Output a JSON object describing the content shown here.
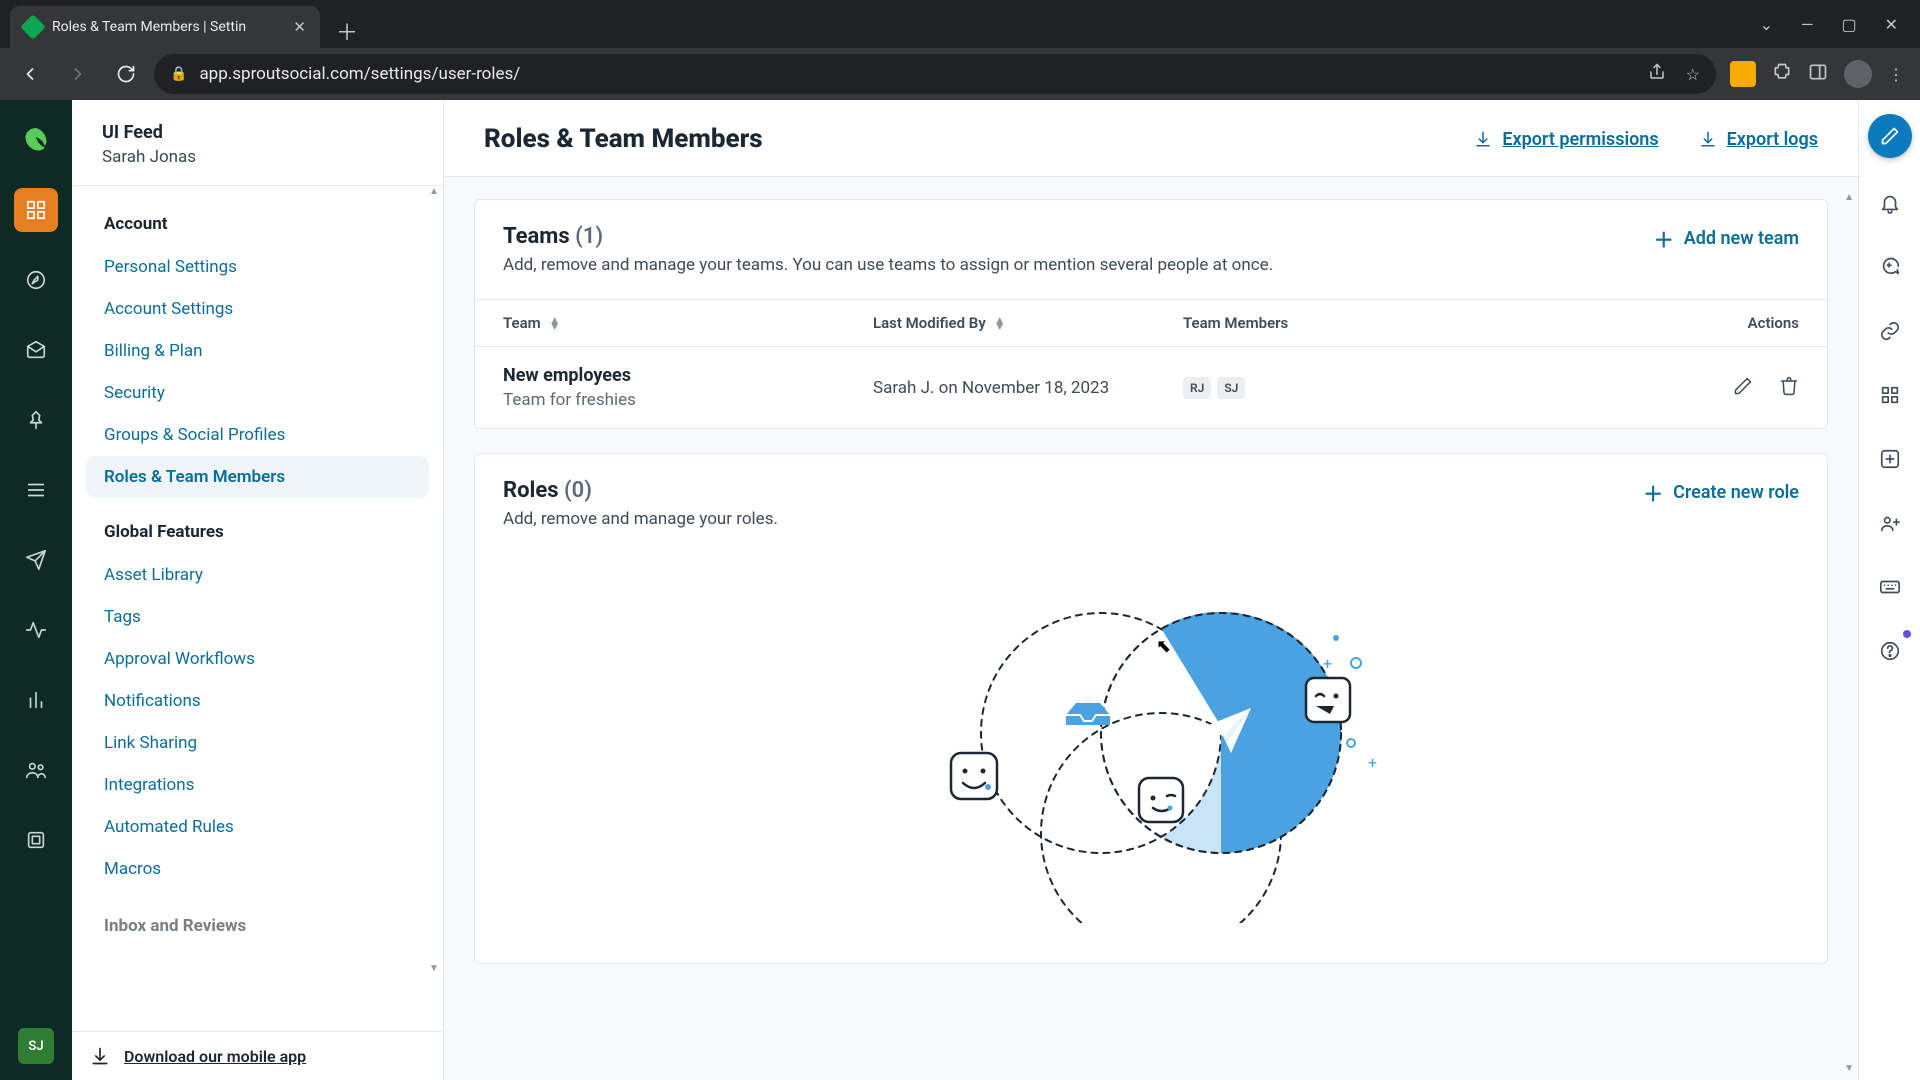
{
  "browser": {
    "tab_title": "Roles & Team Members | Settin",
    "url": "app.sproutsocial.com/settings/user-roles/"
  },
  "sidebar": {
    "org": "UI Feed",
    "user": "Sarah Jonas",
    "user_initials": "SJ",
    "sections": [
      {
        "title": "Account",
        "items": [
          "Personal Settings",
          "Account Settings",
          "Billing & Plan",
          "Security",
          "Groups & Social Profiles",
          "Roles & Team Members"
        ],
        "active_index": 5
      },
      {
        "title": "Global Features",
        "items": [
          "Asset Library",
          "Tags",
          "Approval Workflows",
          "Notifications",
          "Link Sharing",
          "Integrations",
          "Automated Rules",
          "Macros"
        ]
      }
    ],
    "peek_section": "Inbox and Reviews",
    "mobile_cta": "Download our mobile app"
  },
  "header": {
    "title": "Roles & Team Members",
    "export_permissions": "Export permissions",
    "export_logs": "Export logs"
  },
  "teams": {
    "title": "Teams",
    "count": "(1)",
    "subtitle": "Add, remove and manage your teams. You can use teams to assign or mention several people at once.",
    "add_label": "Add new team",
    "columns": {
      "team": "Team",
      "modified": "Last Modified By",
      "members": "Team Members",
      "actions": "Actions"
    },
    "rows": [
      {
        "name": "New employees",
        "desc": "Team for freshies",
        "modified": "Sarah J. on November 18, 2023",
        "member_initials": [
          "RJ",
          "SJ"
        ]
      }
    ]
  },
  "roles": {
    "title": "Roles",
    "count": "(0)",
    "subtitle": "Add, remove and manage your roles.",
    "create_label": "Create new role"
  }
}
